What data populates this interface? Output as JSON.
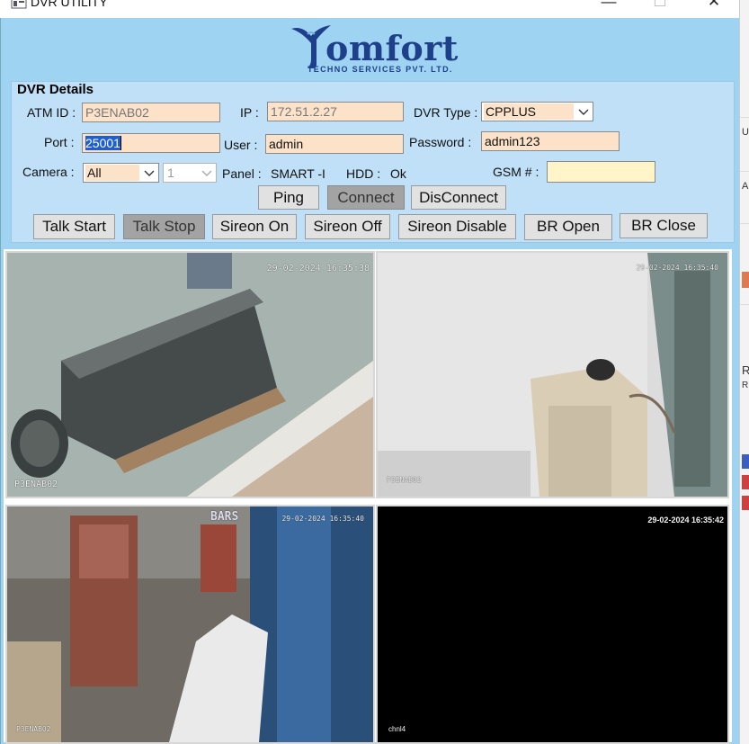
{
  "window": {
    "title": "DVR UTILITY",
    "minimize": "—",
    "maximize": "☐",
    "close": "✕"
  },
  "logo": {
    "brand": "omfort",
    "subtitle": "TECHNO SERVICES PVT. LTD."
  },
  "dvr": {
    "group_title": "DVR Details",
    "atm_id_label": "ATM ID :",
    "atm_id_value": "P3ENAB02",
    "ip_label": "IP :",
    "ip_value": "172.51.2.27",
    "dvr_type_label": "DVR Type :",
    "dvr_type_value": "CPPLUS",
    "port_label": "Port :",
    "port_value": "25001",
    "user_label": "User :",
    "user_value": "admin",
    "password_label": "Password :",
    "password_value": "admin123",
    "camera_label": "Camera :",
    "camera_value": "All",
    "camera_number": "1",
    "panel_label": "Panel :",
    "panel_value": "SMART -I",
    "hdd_label": "HDD :",
    "hdd_value": "Ok",
    "gsm_label": "GSM # :",
    "gsm_value": ""
  },
  "buttons": {
    "ping": "Ping",
    "connect": "Connect",
    "disconnect": "DisConnect",
    "talk_start": "Talk Start",
    "talk_stop": "Talk Stop",
    "sireon_on": "Sireon On",
    "sireon_off": "Sireon Off",
    "sireon_disable": "Sireon Disable",
    "br_open": "BR Open",
    "br_close": "BR Close"
  },
  "cameras": [
    {
      "timestamp": "29-02-2024 16:35:38",
      "label": "P3ENAB02"
    },
    {
      "timestamp": "29-02-2024 16:35:40",
      "label": "P3ENAB02"
    },
    {
      "timestamp": "29-02-2024 16:35:40",
      "label": "P3ENAB02",
      "sign": "BARS"
    },
    {
      "timestamp": "29-02-2024 16:35:42",
      "label": "chnl4"
    }
  ],
  "right_strip": [
    "U",
    "A",
    "R",
    "RD"
  ],
  "colors": {
    "window_bg": "#9fd3f2",
    "group_bg": "#bfe0f7",
    "field_bg": "#fbe2c9",
    "button_bg": "#e1e1e1",
    "button_pressed": "#a3a3a3",
    "brand_blue": "#1e3f8a"
  }
}
